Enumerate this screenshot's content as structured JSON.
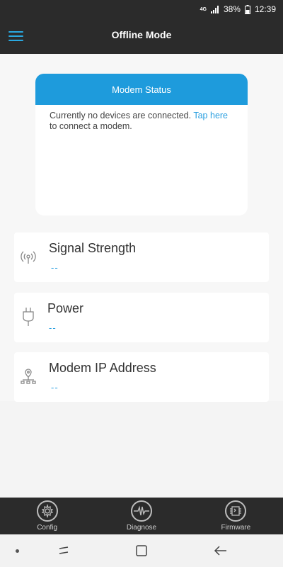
{
  "status_bar": {
    "network": "4G",
    "battery": "38%",
    "time": "12:39"
  },
  "header": {
    "title": "Offline Mode",
    "menu_icon": "hamburger-menu-icon"
  },
  "modem_status": {
    "title": "Modem Status",
    "message_prefix": "Currently no devices are connected. ",
    "link_text": "Tap here",
    "message_suffix": " to connect a modem."
  },
  "rows": [
    {
      "label": "Signal Strength",
      "value": "--",
      "icon": "signal-icon"
    },
    {
      "label": "Power",
      "value": "--",
      "icon": "power-plug-icon"
    },
    {
      "label": "Modem IP Address",
      "value": "--",
      "icon": "network-icon"
    }
  ],
  "tabs": [
    {
      "label": "Config",
      "icon": "gear-icon"
    },
    {
      "label": "Diagnose",
      "icon": "waveform-icon"
    },
    {
      "label": "Firmware",
      "icon": "chip-icon"
    }
  ],
  "colors": {
    "accent": "#1e9bdc",
    "header_bg": "#2b2b2b",
    "link": "#2a9fe0"
  }
}
